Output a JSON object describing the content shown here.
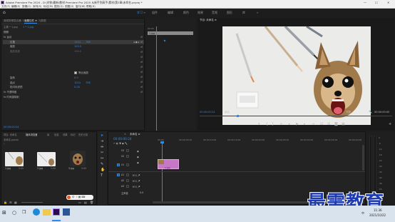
{
  "titlebar": {
    "title": "Adobe Premiere Pro 2020 - D:\\刘铁\\最新\\教材 Premiere Pro 2020 从新手到高手\\素材\\第2章\\未命名.prproj *",
    "minimize": "—",
    "maximize": "☐",
    "close": "✕"
  },
  "menubar": {
    "items": [
      "文件(F)",
      "编辑(E)",
      "剪辑(C)",
      "序列(S)",
      "标记(M)",
      "图形(G)",
      "视图(V)",
      "窗口(W)",
      "帮助(H)"
    ]
  },
  "workspaces": {
    "home": "⌂",
    "tabs": [
      "学习",
      "组件",
      "编辑",
      "颜色",
      "效果",
      "音频",
      "图形",
      "库"
    ],
    "active_index": 0,
    "more": "»"
  },
  "effect_controls": {
    "tabs": [
      "音频剪辑混合器: 1.jpg",
      "效果控件 ≡",
      "元数据"
    ],
    "source": "主要 * 1.jpg",
    "sequence": "1 * 1.jpg",
    "section": "视频",
    "rows": [
      {
        "label": "fx  运动"
      },
      {
        "label": "位置",
        "v1": "1024",
        "v2": "768"
      },
      {
        "label": "缩放",
        "v1": "100.0"
      },
      {
        "label": "缩放宽度",
        "v1": "100.0"
      },
      {
        "label": "等比缩放",
        "checkbox": true
      },
      {
        "label": "旋转",
        "v1": "0.0"
      },
      {
        "label": "锚点",
        "v1": "1024",
        "v2": "768"
      },
      {
        "label": "防闪烁滤镜",
        "v1": "0.00"
      },
      {
        "label": "fx  不透明度"
      },
      {
        "label": "fx  时间重映射"
      }
    ],
    "timeline_label": "00:00",
    "clip_label": "1.jpg",
    "timecode": "00:00:00:24"
  },
  "monitor": {
    "tab": "节目: 未命名 ≡",
    "timecode": "00:00:00:24",
    "fit": "适合",
    "quality": "完整",
    "duration": "00:00:00:00"
  },
  "project": {
    "tabs": [
      "项目: 未命名",
      "媒体浏览器",
      "库",
      "信息",
      "效果",
      "标记",
      "历史记录"
    ],
    "path": "未命名.prproj",
    "items": [
      {
        "name": "1.jpg",
        "duration": "5:00"
      },
      {
        "name": "2.jpg",
        "duration": "5:00"
      },
      {
        "name": "3.jpg",
        "duration": "5:00"
      }
    ]
  },
  "timeline": {
    "tab": "未命名 ≡",
    "timecode": "00:00:00:24",
    "ruler": [
      "00:00",
      "00:00:05:00",
      "00:00:10:00",
      "00:00:15:00",
      "00:00:20:00",
      "00:00:25:00",
      "00:00:30:00",
      "00:00:35:00",
      "00:00:40:00",
      "00:00:45:00"
    ],
    "video_tracks": [
      "V3",
      "V2",
      "V1"
    ],
    "audio_tracks": [
      "A1",
      "A2",
      "A3"
    ],
    "master": "主声道",
    "master_value": "0.0",
    "clip": "1.jpg"
  },
  "meter": {
    "labels": [
      "0",
      "-6",
      "-12",
      "-18",
      "-24",
      "-30",
      "-36",
      "-42",
      "-48",
      "-54",
      "dB"
    ],
    "solo": "S S"
  },
  "watermark": "最需教育",
  "taskbar": {
    "time": "11:36",
    "date": "2021/10/22",
    "lang": "中"
  },
  "colors": {
    "accent": "#2d8ceb",
    "clip": "#c678c6",
    "panel": "#232323"
  }
}
